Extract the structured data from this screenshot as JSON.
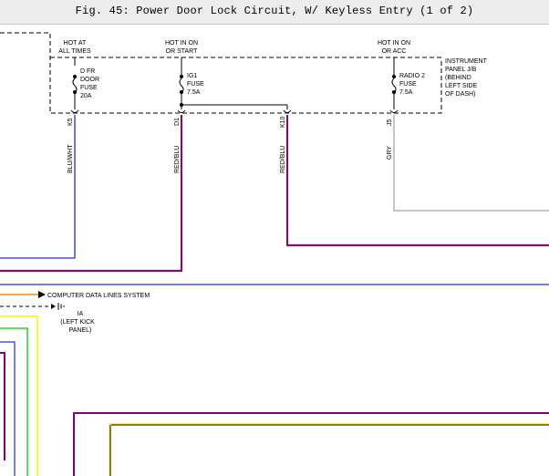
{
  "figure_title": "Fig. 45: Power Door Lock Circuit, W/ Keyless Entry (1 of 2)",
  "sources": {
    "hot_at_all_times": [
      "HOT AT",
      "ALL TIMES"
    ],
    "hot_in_on_or_start": [
      "HOT IN ON",
      "OR START"
    ],
    "hot_in_on_or_acc": [
      "HOT IN ON",
      "OR ACC"
    ]
  },
  "junction_block": [
    "INSTRUMENT",
    "PANEL J/B",
    "(BEHIND",
    "LEFT SIDE",
    "OF DASH)"
  ],
  "fuses": {
    "dfr_door": [
      "D FR",
      "DOOR",
      "FUSE",
      "20A"
    ],
    "ig1": [
      "IG1",
      "FUSE",
      "7.5A"
    ],
    "radio2": [
      "RADIO 2",
      "FUSE",
      "7.5A"
    ]
  },
  "connectors": {
    "k5": "K5",
    "d1": "D1",
    "k10": "K10",
    "j5": "J5"
  },
  "wires": {
    "blu_wht": "BLU/WHT",
    "red_blu_1": "RED/BLU",
    "red_blu_2": "RED/BLU",
    "gry": "GRY"
  },
  "colors": {
    "blu_wht": "#2b2bd6",
    "red_blu": "#7a1270",
    "gry": "#b3b3b3",
    "blue_line": "#2233cc",
    "orange": "#ff8c00",
    "yellow": "#ffee00",
    "green": "#33cc33",
    "purple": "#800080"
  },
  "data_line": "COMPUTER DATA LINES SYSTEM",
  "ground": [
    "IA",
    "(LEFT KICK",
    "PANEL)"
  ]
}
